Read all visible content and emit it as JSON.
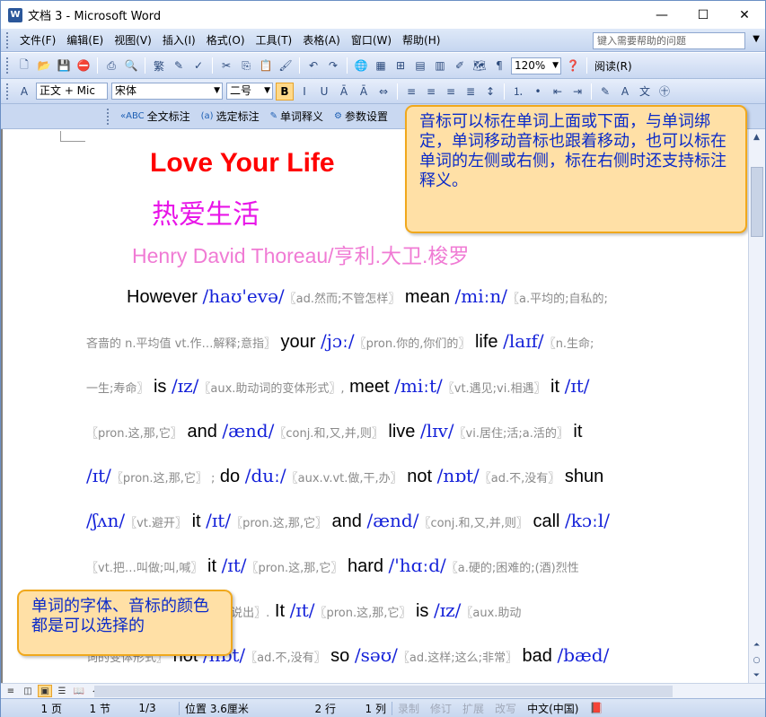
{
  "window": {
    "title": "文档 3 - Microsoft Word",
    "app_icon": "W",
    "controls": {
      "minimize": "—",
      "maximize": "☐",
      "close": "✕"
    }
  },
  "menubar": {
    "items": [
      "文件(F)",
      "编辑(E)",
      "视图(V)",
      "插入(I)",
      "格式(O)",
      "工具(T)",
      "表格(A)",
      "窗口(W)",
      "帮助(H)"
    ],
    "help_placeholder": "键入需要帮助的问题"
  },
  "toolbar_standard": {
    "zoom": "120%",
    "read_label": "阅读(R)"
  },
  "toolbar_format": {
    "style": "正文 + Mic",
    "font": "宋体",
    "size": "二号",
    "bold": "B",
    "italic": "I",
    "underline": "U"
  },
  "toolbar_addin": {
    "full_annotate": "全文标注",
    "selection_annotate": "选定标注",
    "word_meaning": "单词释义",
    "settings": "参数设置"
  },
  "document": {
    "title_en": "Love Your Life",
    "title_zh": "热爱生活",
    "author": "Henry David Thoreau/亨利.大卫.梭罗",
    "lines": [
      [
        {
          "t": "w",
          "v": "However "
        },
        {
          "t": "ph",
          "v": "/haʊ'evə/"
        },
        {
          "t": "df",
          "v": "〖ad.然而;不管怎样〗"
        },
        {
          "t": "w",
          "v": " mean "
        },
        {
          "t": "ph",
          "v": "/miːn/"
        },
        {
          "t": "df",
          "v": "〖a.平均的;自私的;"
        }
      ],
      [
        {
          "t": "df",
          "v": "吝啬的 n.平均值 vt.作…解释;意指〗"
        },
        {
          "t": "w",
          "v": " your "
        },
        {
          "t": "ph",
          "v": "/jɔː/"
        },
        {
          "t": "df",
          "v": "〖pron.你的,你们的〗"
        },
        {
          "t": "w",
          "v": " life "
        },
        {
          "t": "ph",
          "v": "/laɪf/"
        },
        {
          "t": "df",
          "v": "〖n.生命;"
        }
      ],
      [
        {
          "t": "df",
          "v": "一生;寿命〗"
        },
        {
          "t": "w",
          "v": " is "
        },
        {
          "t": "ph",
          "v": "/ɪz/"
        },
        {
          "t": "df",
          "v": "〖aux.助动词的变体形式〗,"
        },
        {
          "t": "w",
          "v": " meet "
        },
        {
          "t": "ph",
          "v": "/miːt/"
        },
        {
          "t": "df",
          "v": "〖vt.遇见;vi.相遇〗"
        },
        {
          "t": "w",
          "v": " it "
        },
        {
          "t": "ph",
          "v": "/ɪt/"
        }
      ],
      [
        {
          "t": "df",
          "v": "〖pron.这,那,它〗"
        },
        {
          "t": "w",
          "v": " and "
        },
        {
          "t": "ph",
          "v": "/ænd/"
        },
        {
          "t": "df",
          "v": "〖conj.和,又,并,则〗"
        },
        {
          "t": "w",
          "v": " live "
        },
        {
          "t": "ph",
          "v": "/lɪv/"
        },
        {
          "t": "df",
          "v": "〖vi.居住;活;a.活的〗"
        },
        {
          "t": "w",
          "v": " it"
        }
      ],
      [
        {
          "t": "ph",
          "v": "/ɪt/"
        },
        {
          "t": "df",
          "v": "〖pron.这,那,它〗 ;"
        },
        {
          "t": "w",
          "v": " do "
        },
        {
          "t": "ph",
          "v": "/duː/"
        },
        {
          "t": "df",
          "v": "〖aux.v.vt.做,干,办〗"
        },
        {
          "t": "w",
          "v": " not "
        },
        {
          "t": "ph",
          "v": "/nɒt/"
        },
        {
          "t": "df",
          "v": "〖ad.不,没有〗"
        },
        {
          "t": "w",
          "v": " shun"
        }
      ],
      [
        {
          "t": "ph",
          "v": "/ʃʌn/"
        },
        {
          "t": "df",
          "v": "〖vt.避开〗"
        },
        {
          "t": "w",
          "v": " it "
        },
        {
          "t": "ph",
          "v": "/ɪt/"
        },
        {
          "t": "df",
          "v": "〖pron.这,那,它〗"
        },
        {
          "t": "w",
          "v": " and "
        },
        {
          "t": "ph",
          "v": "/ænd/"
        },
        {
          "t": "df",
          "v": "〖conj.和,又,并,则〗"
        },
        {
          "t": "w",
          "v": " call "
        },
        {
          "t": "ph",
          "v": "/kɔːl/"
        }
      ],
      [
        {
          "t": "df",
          "v": "〖vt.把…叫做;叫,喊〗"
        },
        {
          "t": "w",
          "v": " it "
        },
        {
          "t": "ph",
          "v": "/ɪt/"
        },
        {
          "t": "df",
          "v": "〖pron.这,那,它〗"
        },
        {
          "t": "w",
          "v": " hard "
        },
        {
          "t": "ph",
          "v": "/'hɑːd/"
        },
        {
          "t": "df",
          "v": "〖a.硬的;困难的;(酒)烈性"
        }
      ],
      [
        {
          "t": "df",
          "v": "的〗 name n.名字;名誉;vt.说出〗."
        },
        {
          "t": "w",
          "v": " It "
        },
        {
          "t": "ph",
          "v": "/ɪt/"
        },
        {
          "t": "df",
          "v": "〖pron.这,那,它〗"
        },
        {
          "t": "w",
          "v": " is "
        },
        {
          "t": "ph",
          "v": "/ɪz/"
        },
        {
          "t": "df",
          "v": "〖aux.助动"
        }
      ],
      [
        {
          "t": "df",
          "v": "词的变体形式〗"
        },
        {
          "t": "w",
          "v": " not "
        },
        {
          "t": "ph",
          "v": "/nɒt/"
        },
        {
          "t": "df",
          "v": "〖ad.不,没有〗"
        },
        {
          "t": "w",
          "v": " so "
        },
        {
          "t": "ph",
          "v": "/səʊ/"
        },
        {
          "t": "df",
          "v": "〖ad.这样;这么;非常〗"
        },
        {
          "t": "w",
          "v": " bad "
        },
        {
          "t": "ph",
          "v": "/bæd/"
        }
      ]
    ]
  },
  "callouts": {
    "top": "音标可以标在单词上面或下面，与单词绑定，单词移动音标也跟着移动，也可以标在单词的左侧或右侧，标在右侧时还支持标注释义。",
    "bottom": "单词的字体、音标的颜色都是可以选择的"
  },
  "statusbar": {
    "page": "1 页",
    "section": "1 节",
    "pages": "1/3",
    "position": "位置 3.6厘米",
    "line": "2 行",
    "column": "1 列",
    "rec": "录制",
    "trk": "修订",
    "ext": "扩展",
    "ovr": "改写",
    "language": "中文(中国)"
  }
}
